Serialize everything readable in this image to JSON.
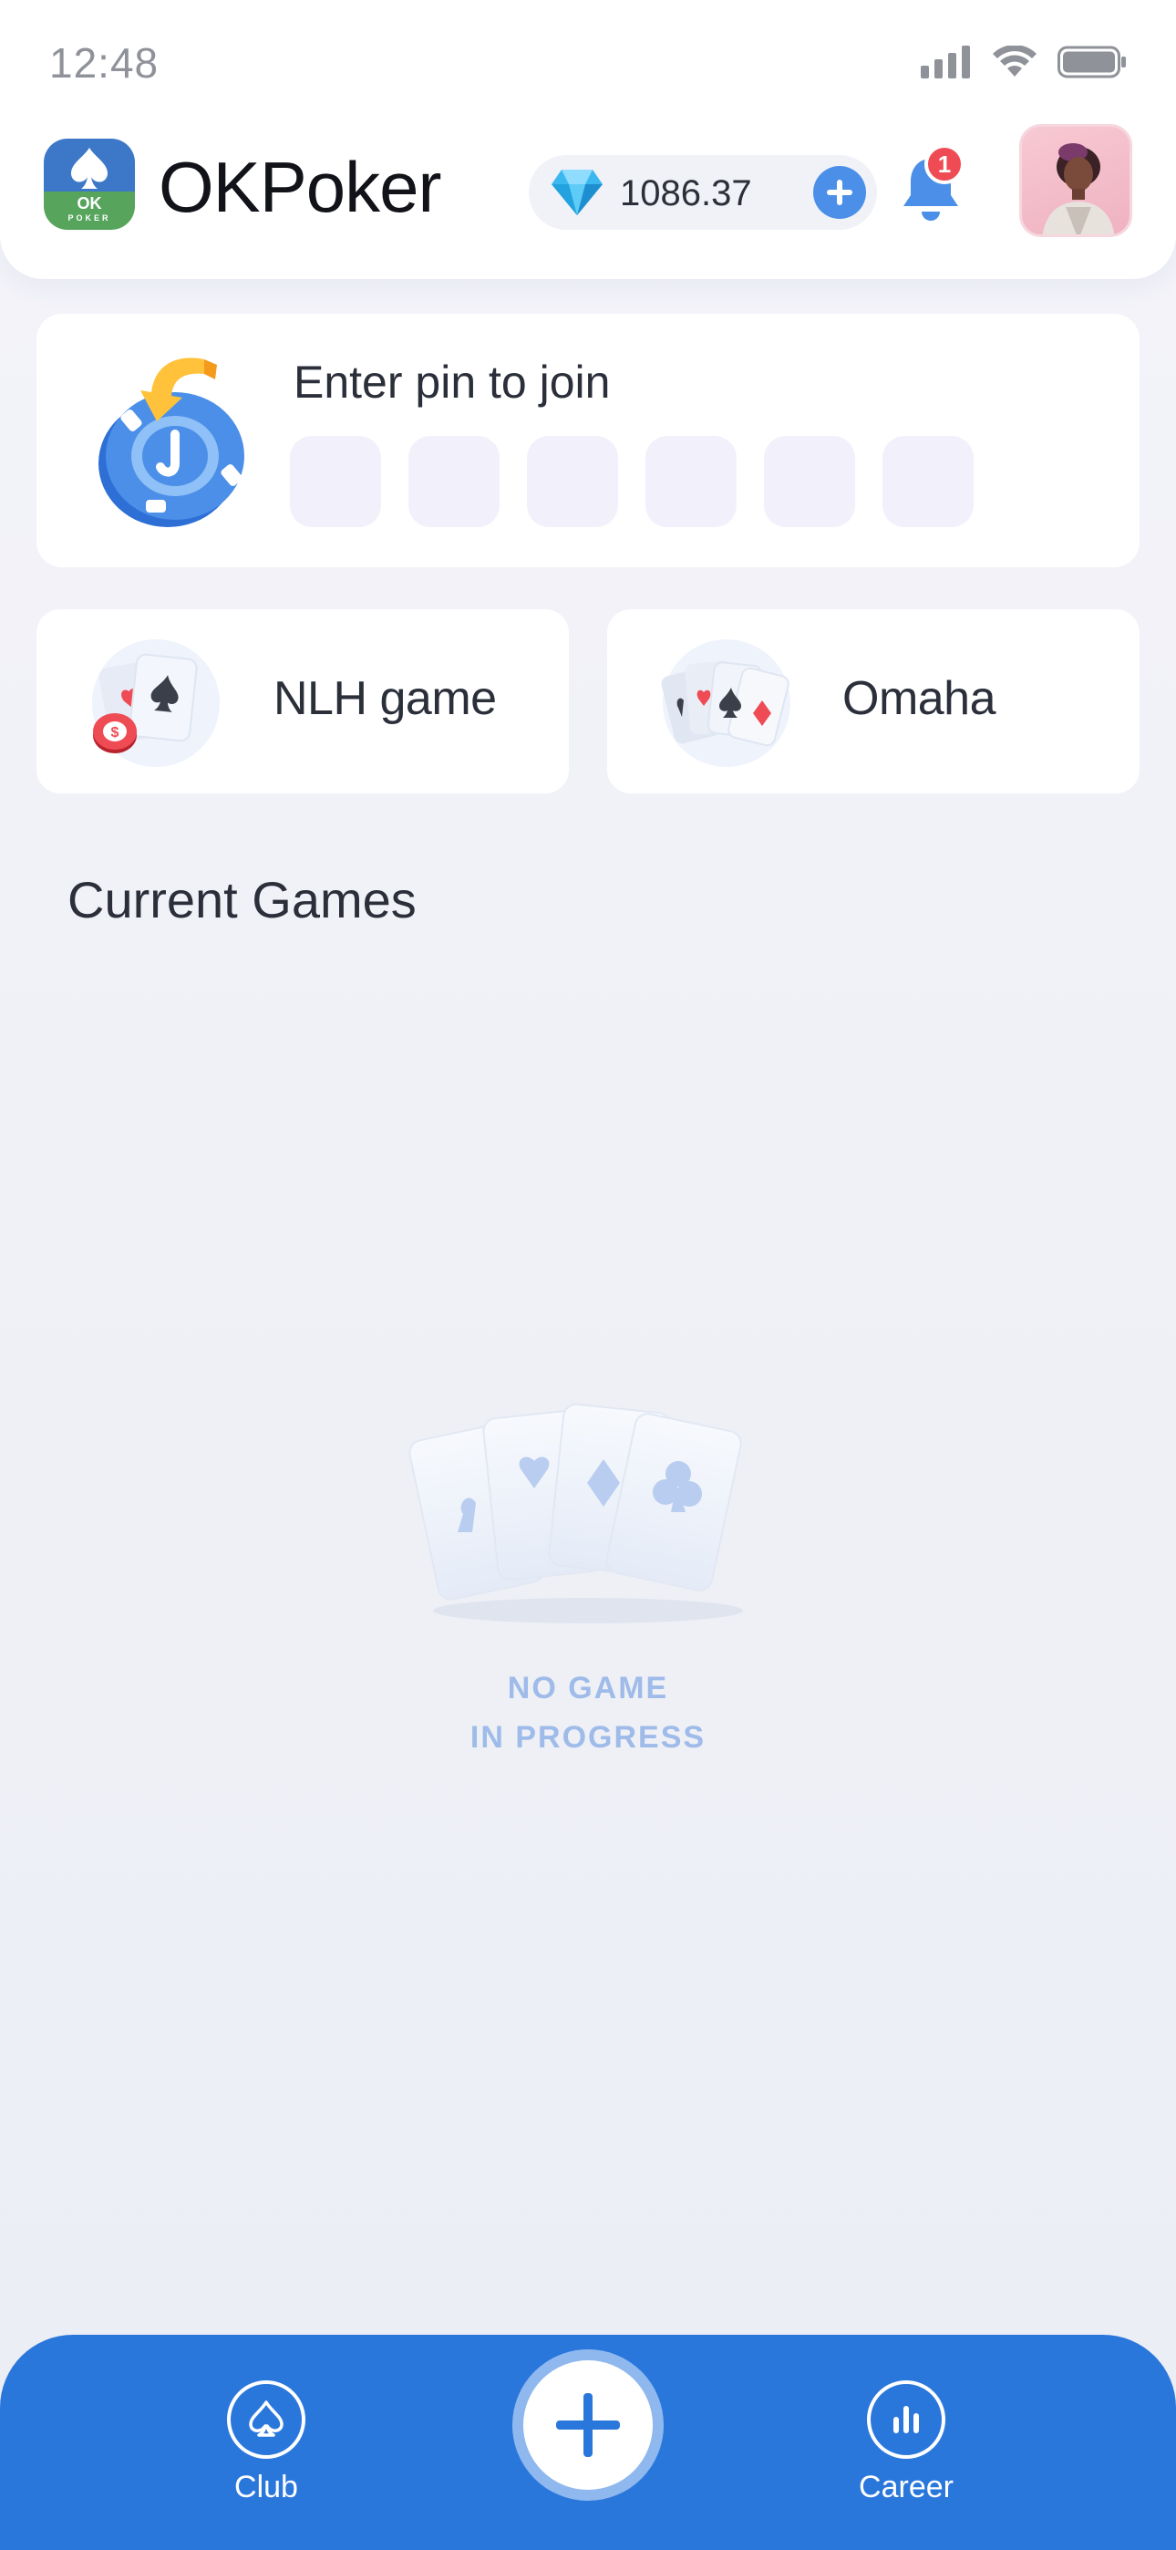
{
  "status_bar": {
    "time": "12:48"
  },
  "header": {
    "app_logo_text": "OK",
    "app_logo_subtext": "POKER",
    "app_title": "OKPoker",
    "balance": "1086.37",
    "notification_count": "1"
  },
  "join": {
    "label": "Enter pin to join",
    "pin_slots": 6
  },
  "game_types": [
    {
      "label": "NLH game"
    },
    {
      "label": "Omaha"
    }
  ],
  "current_games": {
    "title": "Current Games",
    "empty_line1": "NO GAME",
    "empty_line2": "IN PROGRESS"
  },
  "bottom_nav": {
    "club_label": "Club",
    "career_label": "Career"
  },
  "colors": {
    "accent": "#2a77dc",
    "badge": "#ef4b55",
    "empty_text": "#9fbbe9",
    "logo_blue": "#3d78c8",
    "logo_green": "#57a55d"
  },
  "icons": {
    "signal": "signal-icon",
    "wifi": "wifi-icon",
    "battery": "battery-icon",
    "gem": "diamond-gem-icon",
    "add": "plus-icon",
    "bell": "bell-icon",
    "pin": "poker-chip-arrow-icon",
    "nlh": "cards-chip-icon",
    "omaha": "four-cards-icon",
    "club": "spade-icon",
    "career": "bar-chart-icon",
    "fab": "plus-icon"
  }
}
